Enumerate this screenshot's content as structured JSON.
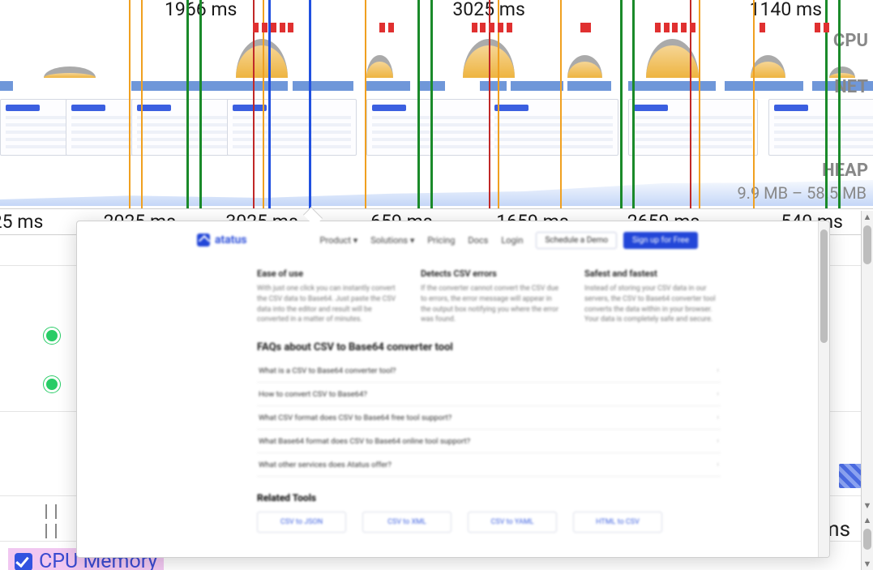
{
  "timeline": {
    "top_timestamps": [
      {
        "label": "1966 ms",
        "left_pct": 23
      },
      {
        "label": "3025 ms",
        "left_pct": 56
      },
      {
        "label": "1140 ms",
        "left_pct": 90
      }
    ],
    "bottom_timestamps": [
      {
        "label": "25 ms",
        "left_pct": 2
      },
      {
        "label": "2025 ms",
        "left_pct": 16
      },
      {
        "label": "3025 ms",
        "left_pct": 30
      },
      {
        "label": "659 ms",
        "left_pct": 46
      },
      {
        "label": "1659 ms",
        "left_pct": 61
      },
      {
        "label": "2659 ms",
        "left_pct": 76
      },
      {
        "label": "540 ms",
        "left_pct": 93
      }
    ],
    "lane_labels": {
      "cpu": "CPU",
      "net": "NET",
      "heap": "HEAP"
    },
    "heap_range": "9.9 MB – 58.5 MB",
    "vlines": [
      {
        "kind": "orange",
        "left_pct": 14.8
      },
      {
        "kind": "orange",
        "left_pct": 16.2
      },
      {
        "kind": "green",
        "left_pct": 21.4
      },
      {
        "kind": "green",
        "left_pct": 22.8
      },
      {
        "kind": "red",
        "left_pct": 29.0
      },
      {
        "kind": "orange",
        "left_pct": 30.1
      },
      {
        "kind": "blue",
        "left_pct": 30.7
      },
      {
        "kind": "blue",
        "left_pct": 35.4
      },
      {
        "kind": "orange",
        "left_pct": 41.8
      },
      {
        "kind": "green",
        "left_pct": 47.8
      },
      {
        "kind": "green",
        "left_pct": 49.3
      },
      {
        "kind": "red",
        "left_pct": 56.0
      },
      {
        "kind": "orange",
        "left_pct": 57.0
      },
      {
        "kind": "orange",
        "left_pct": 64.2
      },
      {
        "kind": "green",
        "left_pct": 71.0
      },
      {
        "kind": "green",
        "left_pct": 72.4
      },
      {
        "kind": "red",
        "left_pct": 79.0
      },
      {
        "kind": "orange",
        "left_pct": 80.0
      },
      {
        "kind": "orange",
        "left_pct": 86.3
      },
      {
        "kind": "green",
        "left_pct": 94.5
      },
      {
        "kind": "green",
        "left_pct": 96.0
      }
    ],
    "red_ticks_pct": [
      29,
      30,
      31,
      32,
      33,
      43.5,
      44.5,
      54,
      55,
      56,
      57,
      58,
      66.5,
      67,
      75,
      76,
      77,
      78,
      79,
      87,
      93.3,
      94.3
    ],
    "cpu_blobs": [
      {
        "cls": "tall",
        "left_pct": 27,
        "w_pct": 6
      },
      {
        "cls": "med",
        "left_pct": 42,
        "w_pct": 3
      },
      {
        "cls": "tall",
        "left_pct": 53,
        "w_pct": 6
      },
      {
        "cls": "med",
        "left_pct": 65,
        "w_pct": 4
      },
      {
        "cls": "tall",
        "left_pct": 74,
        "w_pct": 6
      },
      {
        "cls": "med",
        "left_pct": 86,
        "w_pct": 4
      },
      {
        "cls": "low",
        "left_pct": 5,
        "w_pct": 6
      },
      {
        "cls": "low",
        "left_pct": 95,
        "w_pct": 3
      }
    ],
    "net_bars": [
      {
        "left_pct": 0,
        "w_pct": 1.5
      },
      {
        "left_pct": 15,
        "w_pct": 18
      },
      {
        "left_pct": 33.5,
        "w_pct": 7
      },
      {
        "left_pct": 42,
        "w_pct": 5
      },
      {
        "left_pct": 48,
        "w_pct": 3
      },
      {
        "left_pct": 55,
        "w_pct": 3
      },
      {
        "left_pct": 58.5,
        "w_pct": 6
      },
      {
        "left_pct": 65,
        "w_pct": 5
      },
      {
        "left_pct": 72,
        "w_pct": 10
      },
      {
        "left_pct": 83,
        "w_pct": 9
      },
      {
        "left_pct": 93,
        "w_pct": 7
      }
    ],
    "snaps_left_pct": [
      0,
      7.5,
      15,
      26,
      42,
      56,
      72,
      88
    ],
    "cpu_memory_checkbox": "CPU Memory"
  },
  "popup": {
    "brand": "atatus",
    "nav": {
      "items": [
        "Product ▾",
        "Solutions ▾",
        "Pricing",
        "Docs",
        "Login"
      ],
      "cta_outline": "Schedule a Demo",
      "cta_primary": "Sign up for Free"
    },
    "features": [
      {
        "title": "Ease of use",
        "body": "With just one click you can instantly convert the CSV data to Base64. Just paste the CSV data into the editor and result will be converted in a matter of minutes."
      },
      {
        "title": "Detects CSV errors",
        "body": "If the converter cannot convert the CSV due to errors, the error message will appear in the output box notifying you where the error was found."
      },
      {
        "title": "Safest and fastest",
        "body": "Instead of storing your CSV data in our servers, the CSV to Base64 converter tool converts the data within in your browser. Your data is completely safe and secure."
      }
    ],
    "faq_heading": "FAQs about CSV to Base64 converter tool",
    "faqs": [
      "What is a CSV to Base64 converter tool?",
      "How to convert CSV to Base64?",
      "What CSV format does CSV to Base64 free tool support?",
      "What Base64 format does CSV to Base64 online tool support?",
      "What other services does Atatus offer?"
    ],
    "related_heading": "Related Tools",
    "related": [
      "CSV to JSON",
      "CSV to XML",
      "CSV to YAML",
      "HTML to CSV"
    ]
  }
}
